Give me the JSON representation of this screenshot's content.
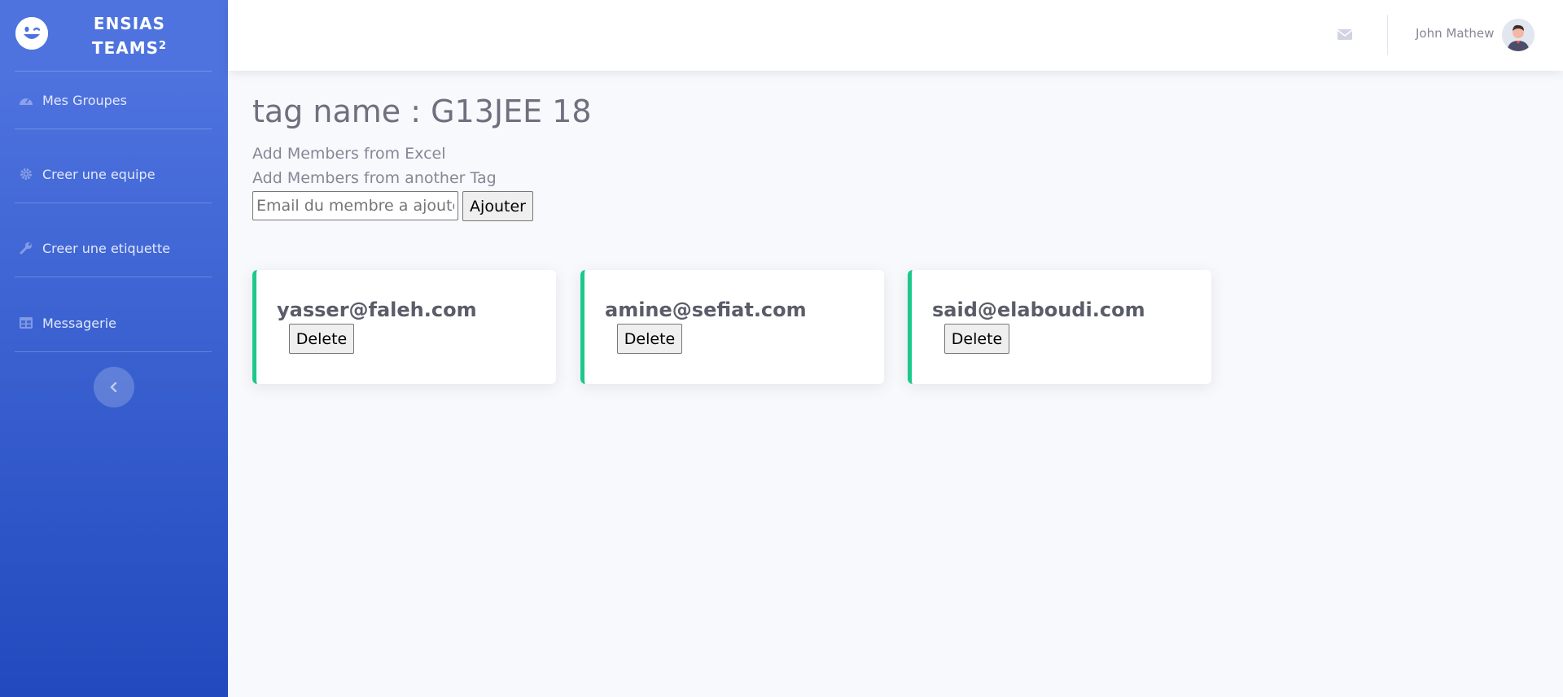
{
  "sidebar": {
    "brand_line1": "ENSIAS",
    "brand_line2": "TEAMS",
    "brand_sup": "2",
    "items": [
      {
        "label": "Mes Groupes",
        "icon": "tachometer-icon"
      },
      {
        "label": "Creer une equipe",
        "icon": "gear-icon"
      },
      {
        "label": "Creer une etiquette",
        "icon": "wrench-icon"
      },
      {
        "label": "Messagerie",
        "icon": "table-icon"
      }
    ],
    "toggle_icon": "chevron-left-icon"
  },
  "topbar": {
    "mail_icon": "envelope-icon",
    "user_name": "John Mathew"
  },
  "main": {
    "title": "tag name : G13JEE 18",
    "add_from_excel": "Add Members from Excel",
    "add_from_tag": "Add Members from another Tag",
    "email_placeholder": "Email du membre a ajouter",
    "add_button": "Ajouter",
    "members": [
      {
        "email": "yasser@faleh.com",
        "delete_label": "Delete"
      },
      {
        "email": "amine@sefiat.com",
        "delete_label": "Delete"
      },
      {
        "email": "said@elaboudi.com",
        "delete_label": "Delete"
      }
    ]
  },
  "colors": {
    "sidebar_top": "#4e73df",
    "sidebar_bottom": "#224abe",
    "card_accent": "#1cc88a",
    "background": "#f8f9fc"
  }
}
